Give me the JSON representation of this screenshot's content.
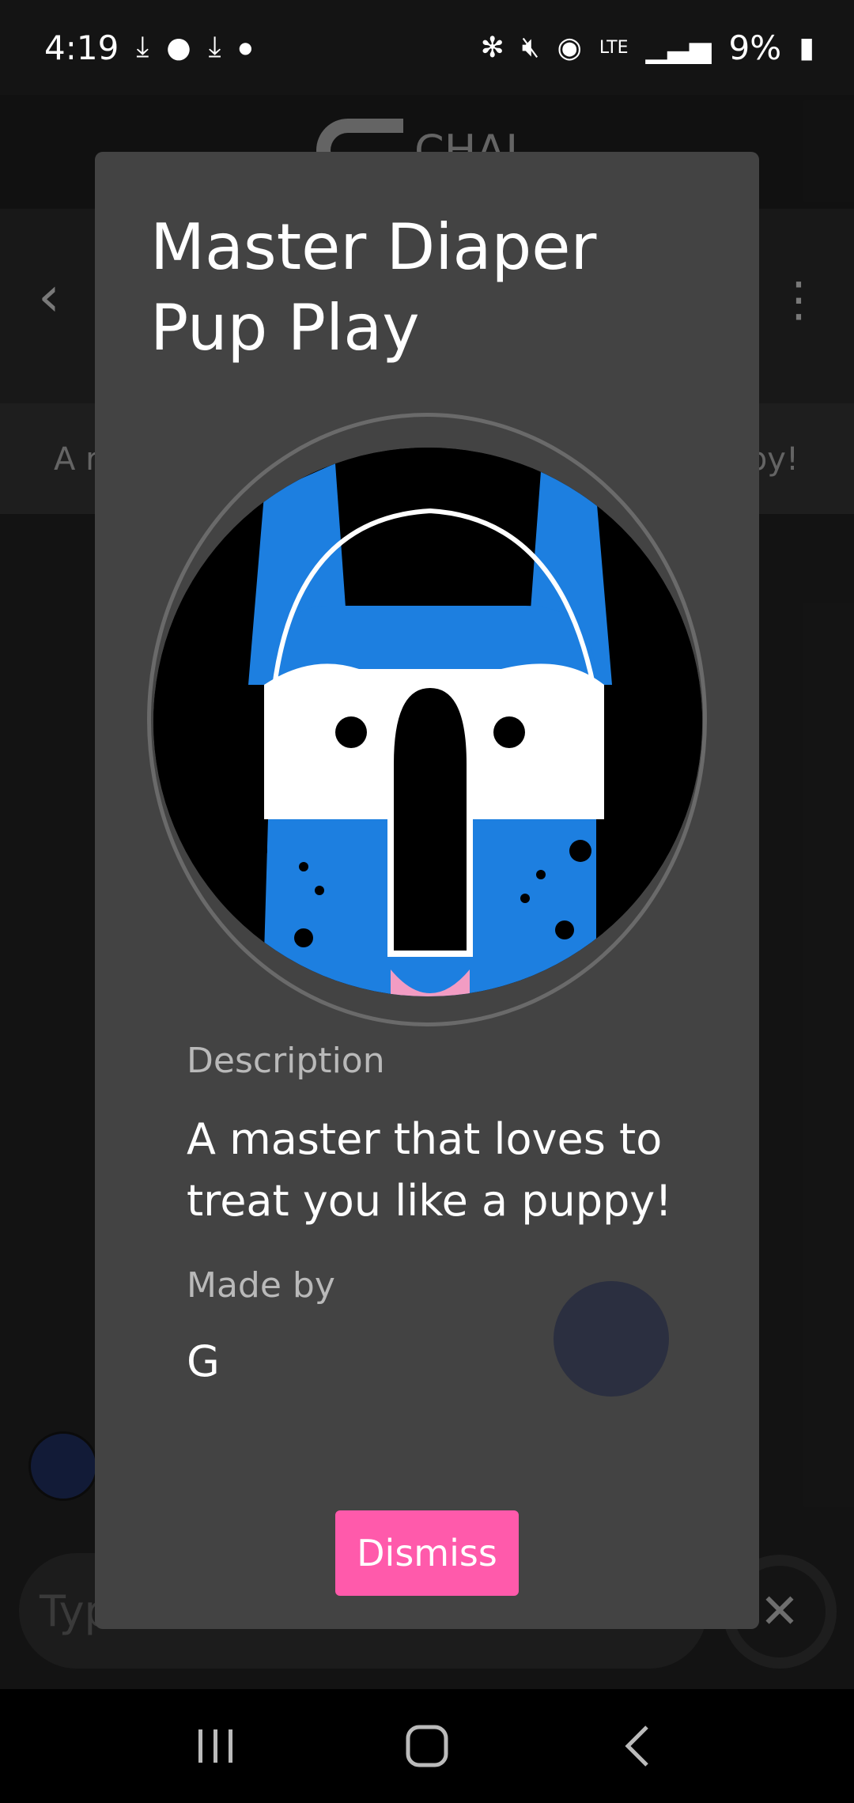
{
  "status_bar": {
    "time": "4:19",
    "battery": "9%",
    "network": "LTE",
    "icons_left": [
      "download-icon",
      "reddit-icon",
      "download-icon",
      "dot-icon"
    ],
    "icons_right": [
      "bluetooth-icon",
      "mute-icon",
      "hotspot-icon",
      "lte-icon",
      "signal-icon",
      "battery-charging-icon"
    ]
  },
  "background": {
    "app_name": "CHAI",
    "description_start": "A r",
    "description_end": "py!",
    "input_placeholder": "Typ"
  },
  "modal": {
    "title": "Master Diaper Pup Play",
    "description_label": "Description",
    "description": "A master that loves to treat you like a puppy!",
    "made_by_label": "Made by",
    "creator": "G",
    "dismiss_label": "Dismiss"
  },
  "colors": {
    "modal_bg": "#434343",
    "accent": "#ff5aab",
    "avatar_blue": "#1d7fe0"
  }
}
